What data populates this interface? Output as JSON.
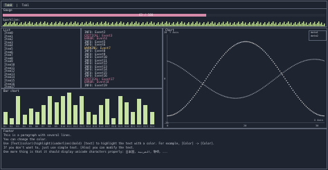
{
  "tabs": [
    "Tab0",
    "Tab1"
  ],
  "gauge": {
    "title": "Gauge",
    "label": "63 / 100",
    "progress": 0.63,
    "color": "#d48aa8"
  },
  "sparkline": {
    "title": "Sparkline:",
    "color": "#c9e3a6"
  },
  "list": {
    "title": "List",
    "items": [
      "Item0",
      "Item1",
      "Item2",
      "Item3",
      "Item4",
      "Item5",
      "Item6",
      "Item7",
      "Item8",
      "Item9",
      "Item10",
      "Item11",
      "Item12",
      "Item13",
      "Item14",
      "Item15",
      "Item16",
      "Item17"
    ]
  },
  "logs": [
    {
      "level": "INFO",
      "event": "Event2",
      "color": "#d0d4dc"
    },
    {
      "level": "CRITICAL",
      "event": "Event3",
      "color": "#d48aa8"
    },
    {
      "level": "ERROR",
      "event": "Event4",
      "color": "#d48aa8"
    },
    {
      "level": "INFO",
      "event": "Event5",
      "color": "#d0d4dc"
    },
    {
      "level": "INFO",
      "event": "Event6",
      "color": "#d0d4dc"
    },
    {
      "level": "WARNING",
      "event": "Event7",
      "color": "#e8c880"
    },
    {
      "level": "INFO",
      "event": "Event8",
      "color": "#d0d4dc"
    },
    {
      "level": "INFO",
      "event": "Event9",
      "color": "#d0d4dc"
    },
    {
      "level": "INFO",
      "event": "Event10",
      "color": "#d0d4dc"
    },
    {
      "level": "INFO",
      "event": "Event11",
      "color": "#d0d4dc"
    },
    {
      "level": "INFO",
      "event": "Event12",
      "color": "#d0d4dc"
    },
    {
      "level": "INFO",
      "event": "Event13",
      "color": "#d0d4dc"
    },
    {
      "level": "INFO",
      "event": "Event14",
      "color": "#d0d4dc"
    },
    {
      "level": "INFO",
      "event": "Event15",
      "color": "#d0d4dc"
    },
    {
      "level": "INFO",
      "event": "Event16",
      "color": "#d0d4dc"
    },
    {
      "level": "CRITICAL",
      "event": "Event17",
      "color": "#d48aa8"
    },
    {
      "level": "ERROR",
      "event": "Event18",
      "color": "#d48aa8"
    },
    {
      "level": "INFO",
      "event": "Event19",
      "color": "#d0d4dc"
    }
  ],
  "barchart": {
    "title": "Bar chart",
    "labels": [
      "B1",
      "B2",
      "B3",
      "B4",
      "B5",
      "B6",
      "B7",
      "B8",
      "B9",
      "B10",
      "B11",
      "B12",
      "B13",
      "B14",
      "B15",
      "B16",
      "B17",
      "B18",
      "B19",
      "B20",
      "B21",
      "B22",
      "B23",
      "B24"
    ],
    "values": [
      4,
      2,
      9,
      3,
      5,
      4,
      6,
      9,
      7,
      9,
      10,
      6,
      9,
      4,
      3,
      6,
      8,
      2,
      9,
      7,
      4,
      8,
      6,
      4
    ],
    "max": 10,
    "bar_color": "#c9e3a6"
  },
  "chart": {
    "title": "Chart",
    "ylabel": "Y Axis",
    "xlabel": "X Axis",
    "y_ticks": [
      "-20",
      "0",
      "20"
    ],
    "x_ticks": [
      "0",
      "20",
      "30"
    ],
    "legend": [
      "data1",
      "data2"
    ]
  },
  "paragraph": {
    "title": "Footer",
    "lines": [
      "This is a paragraph with several lines.",
      "You can change the color.",
      "Use [Text](color)(highlight)(underline)(bold) [text] to highlight the text with a color. For example, [Color] -> [Color].",
      "If you don't want to, just use simple text. [Also] you can modify the text.",
      "One more thing is that it should display unicode characters properly: 日本国, العربية, हिन्दी, ..."
    ]
  }
}
